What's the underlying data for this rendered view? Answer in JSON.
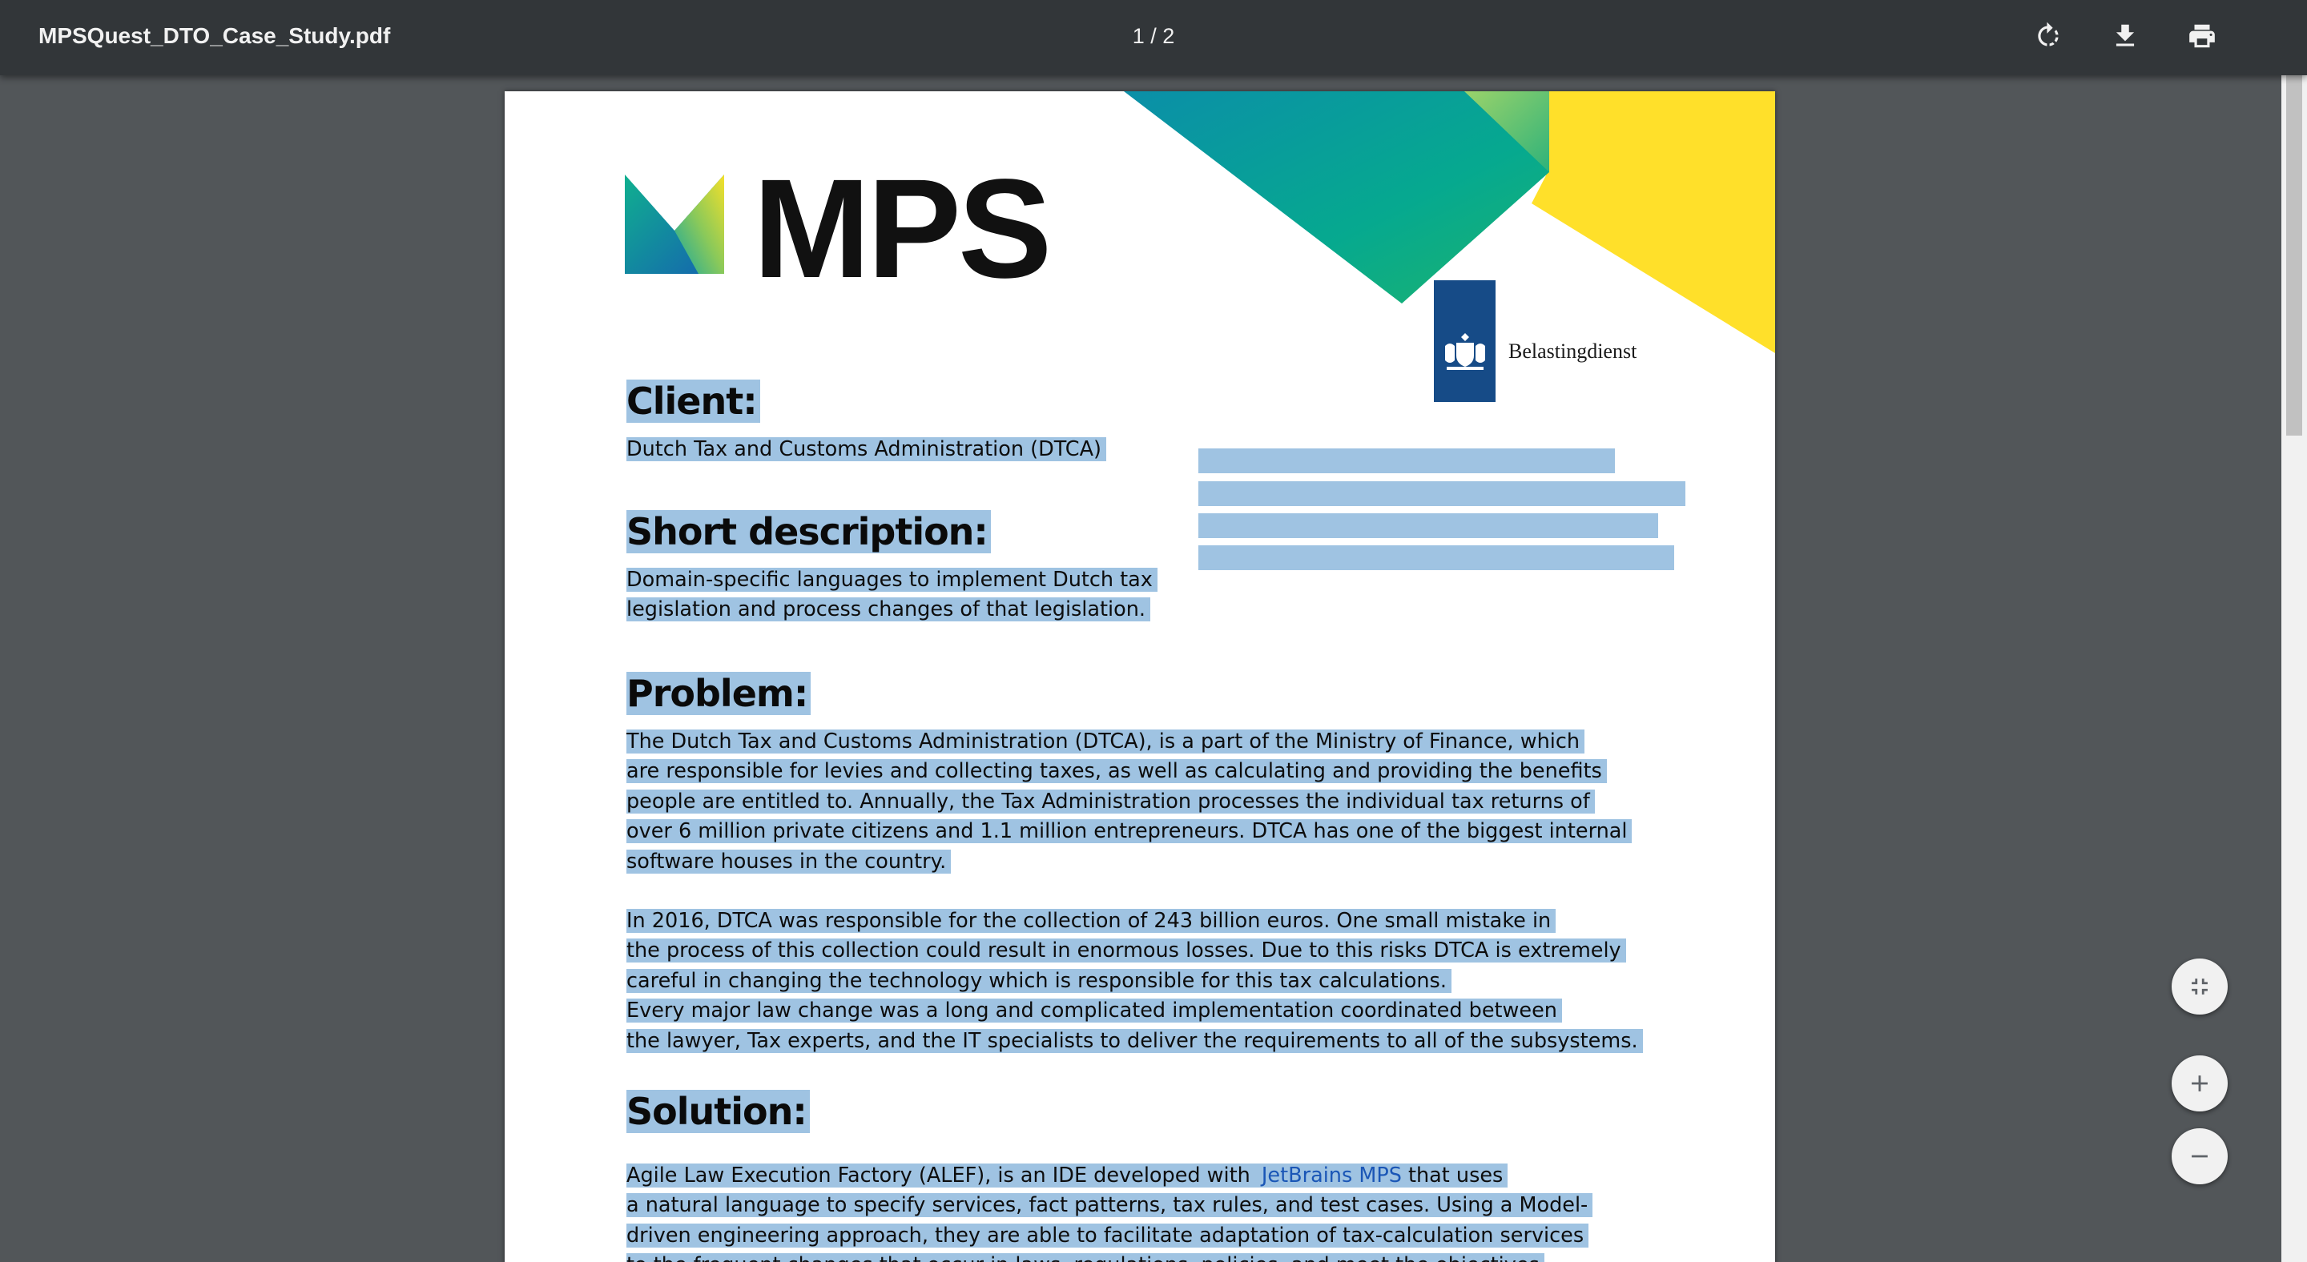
{
  "toolbar": {
    "file_name": "MPSQuest_DTO_Case_Study.pdf",
    "page_indicator": "1 / 2",
    "rotate_icon": "rotate-icon",
    "download_icon": "download-icon",
    "print_icon": "print-icon"
  },
  "document": {
    "logo_text": "MPS",
    "partner_name": "Belastingdienst",
    "client_heading": "Client:",
    "client_text": "Dutch Tax and Customs Administration (DTCA)",
    "short_description_heading": "Short description:",
    "short_description_lines": [
      "Domain-specific languages to implement Dutch tax",
      "legislation and process changes of that legislation."
    ],
    "problem_heading": "Problem:",
    "problem_paragraph_1": [
      "The Dutch Tax and Customs Administration (DTCA), is a part of the Ministry of Finance, which",
      "are responsible for levies and collecting taxes, as well as calculating and providing the benefits",
      "people are entitled to. Annually, the Tax Administration processes the individual tax returns of",
      "over 6 million private citizens and 1.1 million entrepreneurs. DTCA has one of the biggest internal",
      "software houses in the country."
    ],
    "problem_paragraph_2": [
      "In 2016, DTCA was responsible for the collection of 243 billion euros. One small mistake in",
      "the process of this collection could result in enormous losses. Due to this risks DTCA is extremely",
      "careful in changing the technology which is responsible for this tax calculations.",
      "Every major law change was a long and complicated implementation coordinated between",
      "the lawyer, Tax experts, and the IT specialists to deliver the requirements to all of the subsystems."
    ],
    "solution_heading": "Solution:",
    "solution_line_1_before": "Agile Law Execution Factory (ALEF), is an IDE developed with ",
    "solution_line_1_link": "JetBrains MPS",
    "solution_line_1_after": " that uses",
    "solution_lines": [
      "a natural language to specify services, fact patterns, tax rules, and test cases. Using a Model-",
      "driven engineering approach, they are able to facilitate adaptation of tax-calculation services",
      "to the frequent changes that occur in laws, regulations, policies, and meet the objectives"
    ]
  },
  "controls": {
    "fit_icon": "fit-to-page-icon",
    "zoom_in_icon": "zoom-in-icon",
    "zoom_out_icon": "zoom-out-icon"
  },
  "colors": {
    "toolbar": "#323639",
    "viewer_background": "#525659",
    "selection": "#9fc3e2",
    "link": "#1a56b6",
    "brand_teal": "#0aa29a",
    "brand_yellow": "#ffe02a",
    "belastingdienst_blue": "#164b87"
  }
}
